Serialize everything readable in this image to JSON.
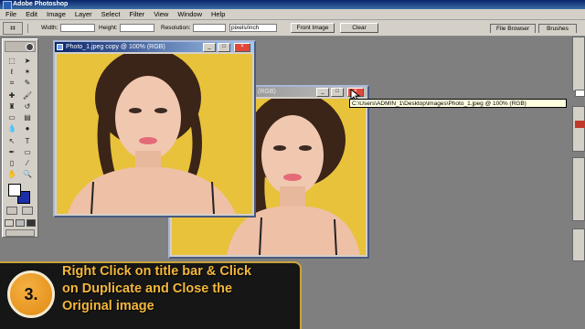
{
  "app": {
    "title": "Adobe Photoshop"
  },
  "menu": [
    "File",
    "Edit",
    "Image",
    "Layer",
    "Select",
    "Filter",
    "View",
    "Window",
    "Help"
  ],
  "options_bar": {
    "width_label": "Width:",
    "height_label": "Height:",
    "resolution_label": "Resolution:",
    "units_value": "pixels/inch",
    "front_image_label": "Front Image",
    "clear_label": "Clear",
    "file_browser_tab": "File Browser",
    "brushes_tab": "Brushes"
  },
  "windows": {
    "copy": {
      "title": "Photo_1.jpeg copy @ 100% (RGB)"
    },
    "original": {
      "title": "(RGB)"
    }
  },
  "tooltip": {
    "text": "C:\\Users\\ADMIN_1\\Desktop\\images\\Photo_1.jpeg @ 100% (RGB)"
  },
  "tutorial": {
    "step_number": "3.",
    "line1": "Right Click on title bar & Click",
    "line2": "on Duplicate and Close the",
    "line3": "Original image"
  },
  "colors": {
    "photo_background": "#e8c23a",
    "banner_text": "#f4b73b",
    "step_circle": "#f0a028",
    "title_active": "#0a246a"
  }
}
